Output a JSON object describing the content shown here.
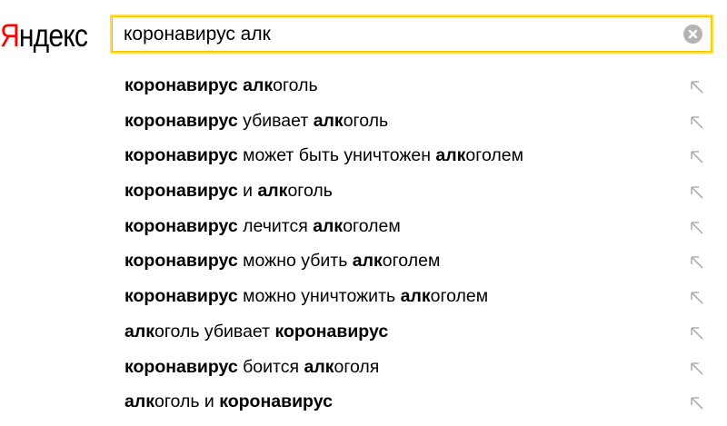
{
  "logo": {
    "first_letter": "Я",
    "rest": "ндекс"
  },
  "search": {
    "value": "коронавирус алк",
    "clear_icon": "clear-circle-icon"
  },
  "suggestions": [
    {
      "parts": [
        {
          "text": "коронавирус",
          "bold": true
        },
        {
          "text": " ",
          "bold": false
        },
        {
          "text": "алк",
          "bold": true
        },
        {
          "text": "оголь",
          "bold": false
        }
      ]
    },
    {
      "parts": [
        {
          "text": "коронавирус",
          "bold": true
        },
        {
          "text": " убивает ",
          "bold": false
        },
        {
          "text": "алк",
          "bold": true
        },
        {
          "text": "оголь",
          "bold": false
        }
      ]
    },
    {
      "parts": [
        {
          "text": "коронавирус",
          "bold": true
        },
        {
          "text": " может быть уничтожен ",
          "bold": false
        },
        {
          "text": "алк",
          "bold": true
        },
        {
          "text": "оголем",
          "bold": false
        }
      ]
    },
    {
      "parts": [
        {
          "text": "коронавирус",
          "bold": true
        },
        {
          "text": " и ",
          "bold": false
        },
        {
          "text": "алк",
          "bold": true
        },
        {
          "text": "оголь",
          "bold": false
        }
      ]
    },
    {
      "parts": [
        {
          "text": "коронавирус",
          "bold": true
        },
        {
          "text": " лечится ",
          "bold": false
        },
        {
          "text": "алк",
          "bold": true
        },
        {
          "text": "оголем",
          "bold": false
        }
      ]
    },
    {
      "parts": [
        {
          "text": "коронавирус",
          "bold": true
        },
        {
          "text": " можно убить ",
          "bold": false
        },
        {
          "text": "алк",
          "bold": true
        },
        {
          "text": "оголем",
          "bold": false
        }
      ]
    },
    {
      "parts": [
        {
          "text": "коронавирус",
          "bold": true
        },
        {
          "text": " можно уничтожить ",
          "bold": false
        },
        {
          "text": "алк",
          "bold": true
        },
        {
          "text": "оголем",
          "bold": false
        }
      ]
    },
    {
      "parts": [
        {
          "text": "алк",
          "bold": true
        },
        {
          "text": "оголь убивает ",
          "bold": false
        },
        {
          "text": "коронавирус",
          "bold": true
        }
      ]
    },
    {
      "parts": [
        {
          "text": "коронавирус",
          "bold": true
        },
        {
          "text": " боится ",
          "bold": false
        },
        {
          "text": "алк",
          "bold": true
        },
        {
          "text": "оголя",
          "bold": false
        }
      ]
    },
    {
      "parts": [
        {
          "text": "алк",
          "bold": true
        },
        {
          "text": "оголь и ",
          "bold": false
        },
        {
          "text": "коронавирус",
          "bold": true
        }
      ]
    }
  ],
  "suggestion_icon": "arrow-up-left-icon",
  "colors": {
    "logo_accent": "#ff0000",
    "search_border": "#ffdb4d",
    "arrow": "#b0b0b0",
    "clear": "#b3b3b3"
  }
}
